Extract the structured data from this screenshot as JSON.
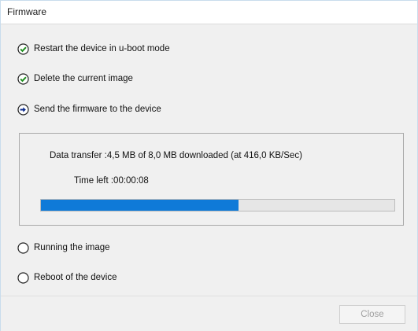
{
  "window": {
    "title": "Firmware"
  },
  "steps": [
    {
      "label": "Restart the device in u-boot mode",
      "state": "done",
      "icon": "check-circle-icon"
    },
    {
      "label": "Delete the current image",
      "state": "done",
      "icon": "check-circle-icon"
    },
    {
      "label": "Send the firmware to the device",
      "state": "active",
      "icon": "arrow-right-circle-icon"
    },
    {
      "label": "Running the image",
      "state": "pending",
      "icon": "empty-circle-icon"
    },
    {
      "label": "Reboot of the device",
      "state": "pending",
      "icon": "empty-circle-icon"
    }
  ],
  "progress": {
    "transfer_text": "Data transfer :4,5 MB of 8,0 MB downloaded (at 416,0 KB/Sec)",
    "time_left_text": "Time left :00:00:08",
    "fraction": 0.56,
    "bar_color": "#0f7ad8"
  },
  "footer": {
    "close_label": "Close",
    "close_enabled": false
  },
  "colors": {
    "done_icon": "#1e8e1e",
    "active_icon": "#0a2a8c",
    "text": "#111111"
  }
}
